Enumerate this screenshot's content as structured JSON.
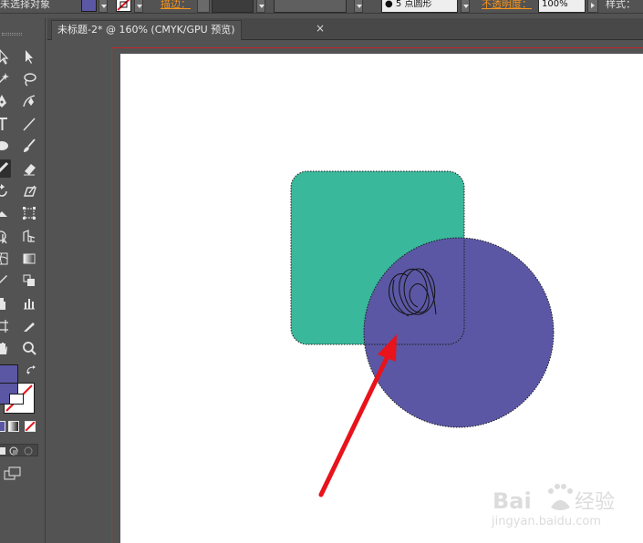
{
  "control_bar": {
    "selection_label": "未选择对象",
    "stroke_label": "描边：",
    "stroke_value": "",
    "brush_dot": "●",
    "brush_label": "5 点圆形",
    "opacity_label": "不透明度：",
    "opacity_value": "100%",
    "style_label": "样式："
  },
  "document": {
    "tab_title": "未标题-2* @ 160% (CMYK/GPU 预览)",
    "close_glyph": "×"
  },
  "colors": {
    "fill": "#5b57a4",
    "teal": "#39b89c",
    "circle": "#5b57a4",
    "arrow": "#e8131b",
    "bleed": "#c1272d",
    "watermark": "#dcdcdc"
  },
  "watermark": {
    "logo_text": "Bai",
    "logo_text_2": "经验",
    "url": "jingyan.baidu.com"
  }
}
